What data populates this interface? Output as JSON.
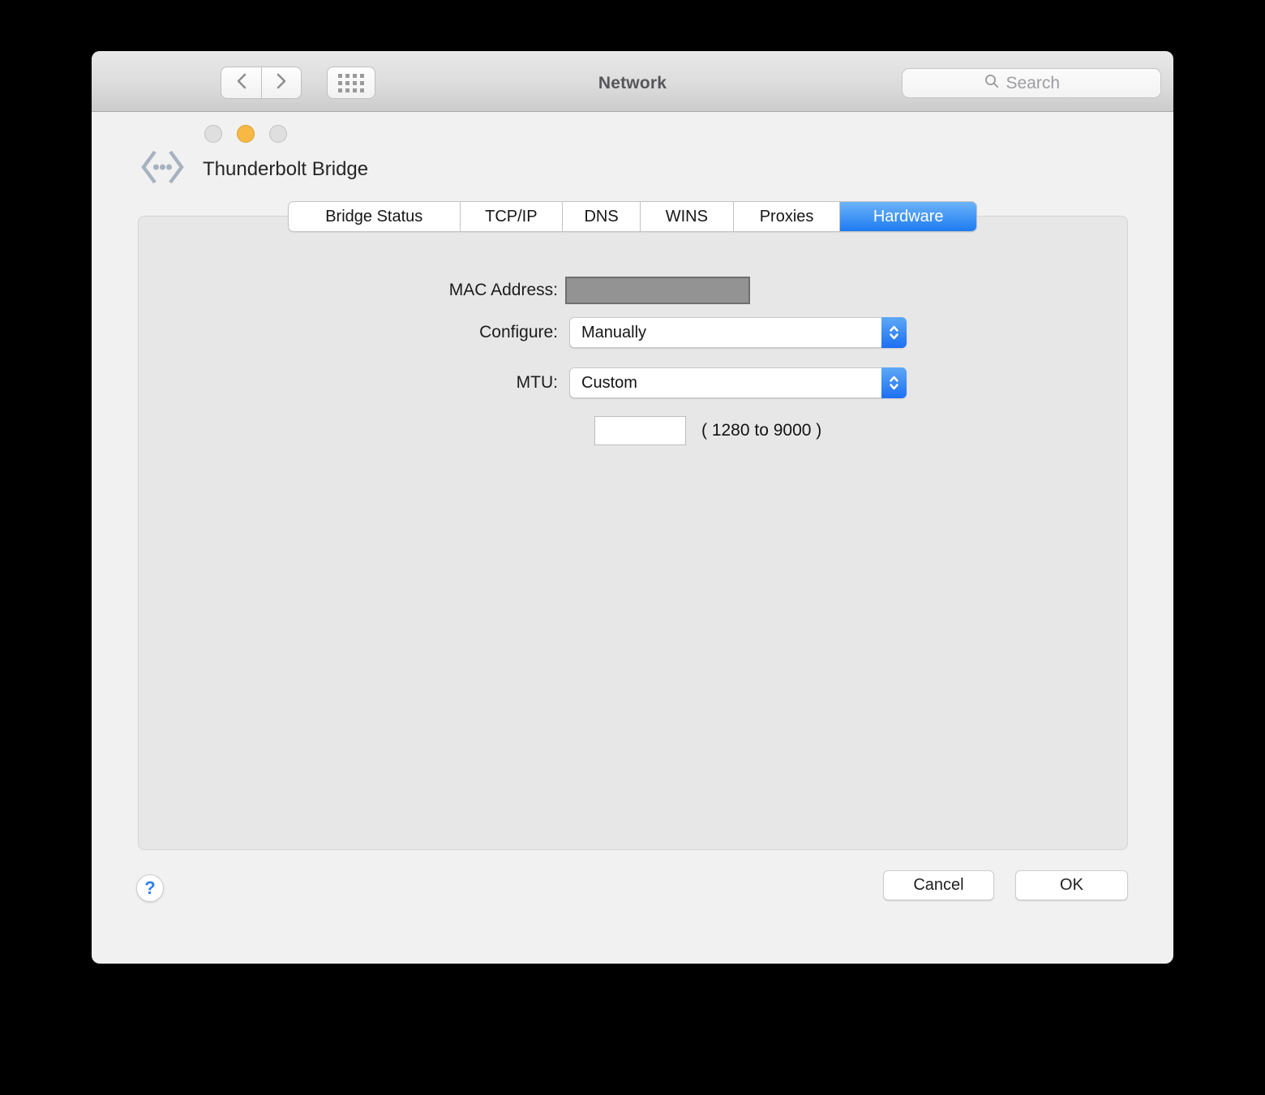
{
  "titlebar": {
    "title": "Network",
    "search_placeholder": "Search"
  },
  "connection": {
    "name": "Thunderbolt Bridge"
  },
  "tabs": {
    "items": [
      {
        "label": "Bridge Status"
      },
      {
        "label": "TCP/IP"
      },
      {
        "label": "DNS"
      },
      {
        "label": "WINS"
      },
      {
        "label": "Proxies"
      },
      {
        "label": "Hardware"
      }
    ],
    "selected": "Hardware"
  },
  "form": {
    "mac_address_label": "MAC Address:",
    "configure_label": "Configure:",
    "configure_value": "Manually",
    "mtu_label": "MTU:",
    "mtu_value": "Custom",
    "mtu_custom_value": "",
    "mtu_range_hint": "( 1280 to 9000 )"
  },
  "footer": {
    "help_label": "?",
    "cancel_label": "Cancel",
    "ok_label": "OK"
  },
  "colors": {
    "selected_tab_blue_top": "#6cb3f8",
    "selected_tab_blue_bottom": "#1d7bf1",
    "minimize_yellow": "#f7b944",
    "help_blue": "#2d7ff3",
    "mac_box_grey": "#939393"
  }
}
